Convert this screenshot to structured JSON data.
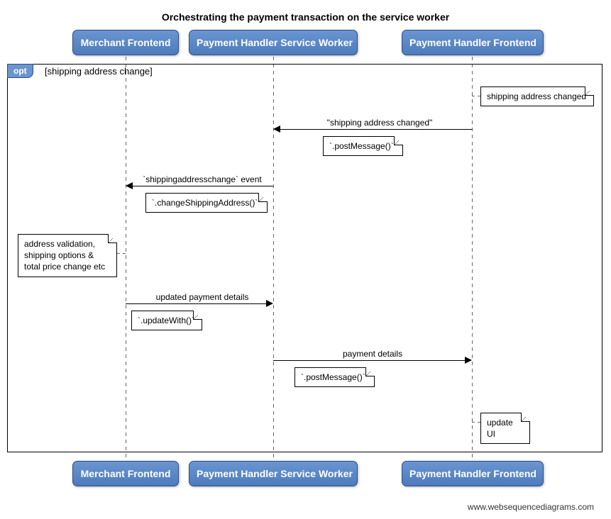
{
  "title": "Orchestrating the payment transaction on the service worker",
  "participants": {
    "p1": "Merchant Frontend",
    "p2": "Payment Handler Service Worker",
    "p3": "Payment Handler Frontend"
  },
  "opt": {
    "tag": "opt",
    "guard": "[shipping address change]"
  },
  "notes": {
    "n1": "shipping address changed",
    "n2": "`.postMessage()`",
    "n3": "`.changeShippingAddress()`",
    "n4": "address validation,\nshipping options &\ntotal price change etc",
    "n5": "`.updateWith()`",
    "n6": "`.postMessage()`",
    "n7": "update UI"
  },
  "messages": {
    "m1": "\"shipping address changed\"",
    "m2": "`shippingaddresschange` event",
    "m3": "updated payment details",
    "m4": "payment details"
  },
  "watermark": "www.websequencediagrams.com"
}
